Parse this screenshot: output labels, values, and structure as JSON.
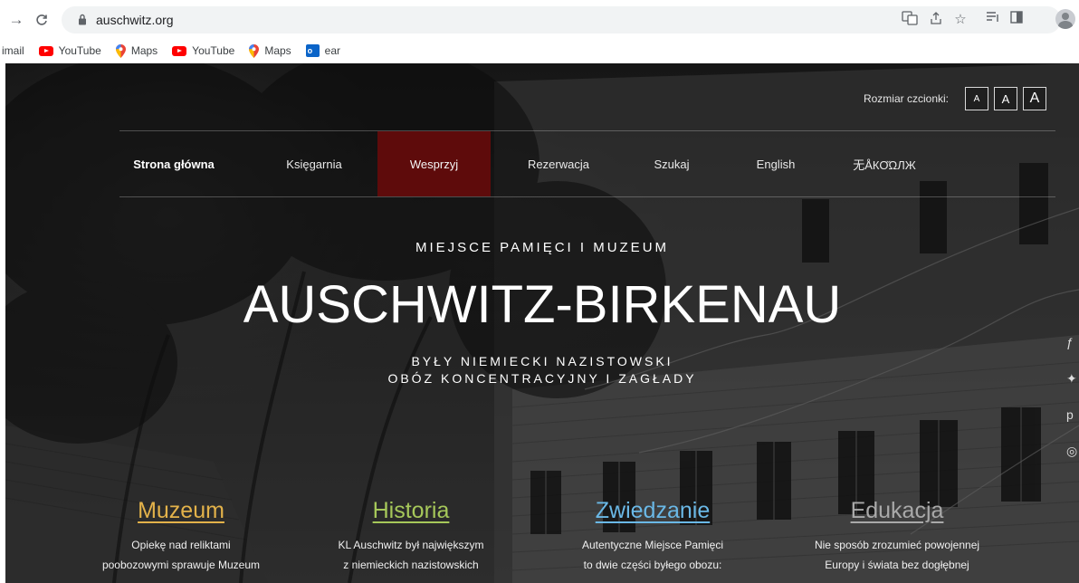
{
  "browser": {
    "url": "auschwitz.org",
    "bookmarks": [
      {
        "label": "imail",
        "icon": "none"
      },
      {
        "label": "YouTube",
        "icon": "youtube-icon"
      },
      {
        "label": "Maps",
        "icon": "maps-icon"
      },
      {
        "label": "YouTube",
        "icon": "youtube-icon"
      },
      {
        "label": "Maps",
        "icon": "maps-icon"
      },
      {
        "label": "ear",
        "icon": "outlook-icon"
      }
    ],
    "toolbar_icons": [
      "translate-icon",
      "share-icon",
      "star-icon",
      "reading-list-icon",
      "sidepanel-icon",
      "profile-icon"
    ]
  },
  "header": {
    "font_size_label": "Rozmiar czcionki:",
    "font_sizes": [
      "A",
      "A",
      "A"
    ]
  },
  "nav": {
    "items": [
      {
        "label": "Strona główna"
      },
      {
        "label": "Księgarnia"
      },
      {
        "label": "Wesprzyj"
      },
      {
        "label": "Rezerwacja"
      },
      {
        "label": "Szukaj"
      },
      {
        "label": "English"
      },
      {
        "label": "无ÅКО̆ΩЛЖ"
      }
    ]
  },
  "hero": {
    "kicker": "MIEJSCE PAMIĘCI I MUZEUM",
    "title": "AUSCHWITZ-BIRKENAU",
    "subtitle_line1": "BYŁY NIEMIECKI NAZISTOWSKI",
    "subtitle_line2": "OBÓZ KONCENTRACYJNY I ZAGŁADY"
  },
  "features": [
    {
      "title": "Muzeum",
      "line1": "Opiekę nad reliktami",
      "line2": "poobozowymi sprawuje Muzeum",
      "color": "#e3b24a"
    },
    {
      "title": "Historia",
      "line1": "KL Auschwitz był największym",
      "line2": "z niemieckich nazistowskich",
      "color": "#a6c85a"
    },
    {
      "title": "Zwiedzanie",
      "line1": "Autentyczne Miejsce Pamięci",
      "line2": "to dwie części byłego obozu:",
      "color": "#6ab8e6"
    },
    {
      "title": "Edukacja",
      "line1": "Nie sposób zrozumieć powojennej",
      "line2": "Europy i świata bez dogłębnej",
      "color": "#a9a9a9"
    }
  ],
  "colors": {
    "nav_active": "#5e0b0b"
  }
}
